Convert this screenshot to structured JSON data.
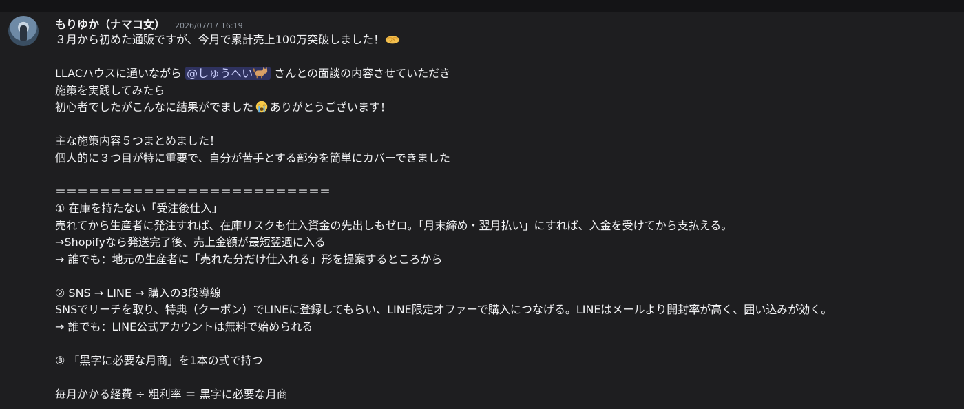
{
  "message": {
    "author": "もりゆか（ナマコ女）",
    "timestamp": "2026/07/17 16:19",
    "avatar_icon": "user-avatar-photo",
    "lines": {
      "l1": "３月から初めた通販ですが、今月で累計売上100万突破しました！",
      "l2_pre": "LLACハウスに通いながら ",
      "l2_mention": "@しゅうへい",
      "l2_post": " さんとの面談の内容させていただき",
      "l3": "施策を実践してみたら",
      "l4_pre": "初心者でしたがこんなに結果がでました",
      "l4_post": "ありがとうございます！",
      "l5": "主な施策内容５つまとめました！",
      "l6": "個人的に３つ目が特に重要で、自分が苦手とする部分を簡単にカバーできました",
      "l7": "＝＝＝＝＝＝＝＝＝＝＝＝＝＝＝＝＝＝＝＝＝＝＝＝＝",
      "l8": "① 在庫を持たない「受注後仕入」",
      "l9": "売れてから生産者に発注すれば、在庫リスクも仕入資金の先出しもゼロ。「月末締め・翌月払い」にすれば、入金を受けてから支払える。",
      "l10": "→Shopifyなら発送完了後、売上金額が最短翌週に入る",
      "l11": "→ 誰でも：地元の生産者に「売れた分だけ仕入れる」形を提案するところから",
      "l12": "② SNS → LINE → 購入の3段導線",
      "l13": "SNSでリーチを取り、特典（クーポン）でLINEに登録してもらい、LINE限定オファーで購入につなげる。LINEはメールより開封率が高く、囲い込みが効く。",
      "l14": "→ 誰でも：LINE公式アカウントは無料で始められる",
      "l15": "③ 「黒字に必要な月商」を1本の式で持つ",
      "l16": "毎月かかる経費 ÷ 粗利率 ＝ 黒字に必要な月商"
    },
    "emojis": {
      "handshake": "handshake-emoji",
      "cat": "cat-emoji",
      "crying": "crying-face-emoji"
    }
  },
  "colors": {
    "background": "#1e1e20",
    "text": "#f2f3f5",
    "timestamp": "#949ba4",
    "mention_bg": "#4a4f8a",
    "mention_text": "#c9cdfb"
  }
}
